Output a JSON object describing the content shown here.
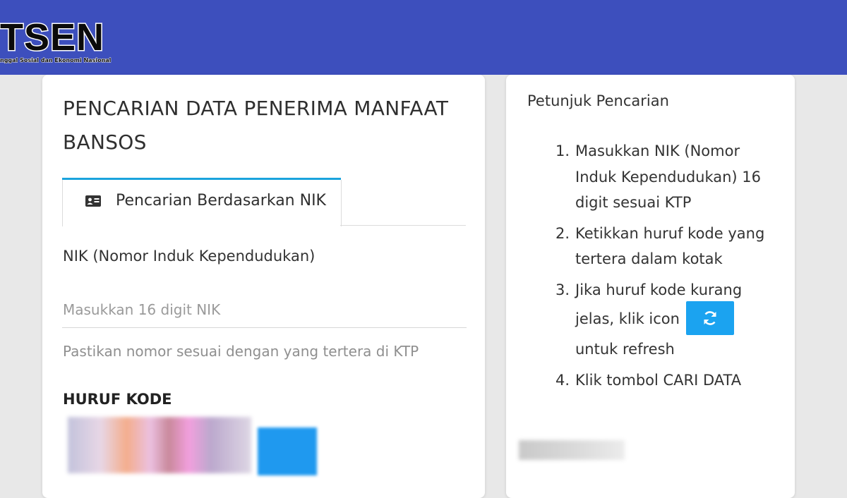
{
  "header": {
    "logo_text": "TSEN",
    "logo_subtitle": "nggal Sosial dan Ekonomi Nasional",
    "bg_color": "#3d4fbd"
  },
  "search_card": {
    "title": "PENCARIAN DATA PENERIMA MANFAAT BANSOS",
    "tab": {
      "icon": "id-card-icon",
      "label": "Pencarian Berdasarkan NIK",
      "accent_color": "#1aa3dd"
    },
    "nik_field": {
      "label": "NIK (Nomor Induk Kependudukan)",
      "placeholder": "Masukkan 16 digit NIK",
      "value": "",
      "hint": "Pastikan nomor sesuai dengan yang tertera di KTP"
    },
    "captcha": {
      "label": "HURUF KODE"
    }
  },
  "instructions": {
    "title": "Petunjuk Pencarian",
    "steps": [
      {
        "num": "1.",
        "text": "Masukkan NIK (Nomor Induk Kependudukan) 16 digit sesuai KTP"
      },
      {
        "num": "2.",
        "text": "Ketikkan huruf kode yang tertera dalam kotak"
      },
      {
        "num": "3.",
        "text_before": "Jika huruf kode kurang jelas, klik icon",
        "icon": "refresh-icon",
        "text_after": "untuk refresh"
      },
      {
        "num": "4.",
        "text": "Klik tombol CARI DATA"
      }
    ],
    "refresh_color": "#1ba3f0"
  }
}
